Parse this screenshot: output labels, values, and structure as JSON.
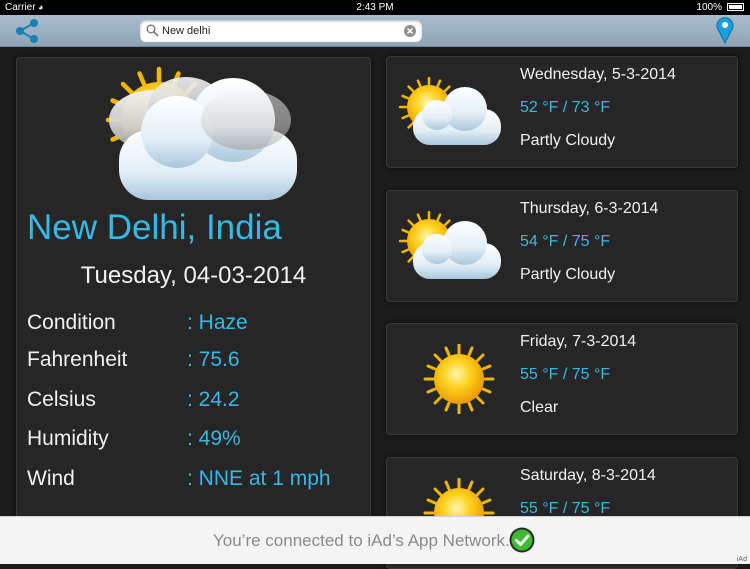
{
  "status_bar": {
    "carrier": "Carrier",
    "time": "2:43 PM",
    "battery": "100%"
  },
  "nav": {
    "search_value": "New delhi",
    "icons": [
      "share-icon",
      "search-icon",
      "clear-icon",
      "location-pin-icon"
    ]
  },
  "current": {
    "city": "New Delhi, India",
    "date": "Tuesday, 04-03-2014",
    "icon": "partly-cloudy-icon",
    "details": [
      {
        "label": "Condition",
        "value": ": Haze"
      },
      {
        "label": "Fahrenheit",
        "value": ": 75.6"
      },
      {
        "label": "Celsius",
        "value": ": 24.2"
      },
      {
        "label": "Humidity",
        "value": ": 49%"
      },
      {
        "label": "Wind",
        "value": ": NNE at 1 mph"
      }
    ]
  },
  "forecast": [
    {
      "day": "Wednesday, 5-3-2014",
      "temp": "52 °F / 73 °F",
      "condition": "Partly Cloudy",
      "icon": "partly-cloudy-icon"
    },
    {
      "day": "Thursday, 6-3-2014",
      "temp": "54 °F / 75 °F",
      "condition": "Partly Cloudy",
      "icon": "partly-cloudy-icon"
    },
    {
      "day": "Friday, 7-3-2014",
      "temp": "55 °F / 75 °F",
      "condition": "Clear",
      "icon": "sun-icon"
    },
    {
      "day": "Saturday, 8-3-2014",
      "temp": "55 °F / 75 °F",
      "condition": "",
      "icon": "sun-icon"
    }
  ],
  "ad": {
    "text": "You’re connected to iAd’s App Network.",
    "mark": "iAd"
  },
  "colors": {
    "accent": "#36b9e6",
    "panel": "#262626",
    "background": "#1c1c1c",
    "navbar": "#9db2c4"
  }
}
